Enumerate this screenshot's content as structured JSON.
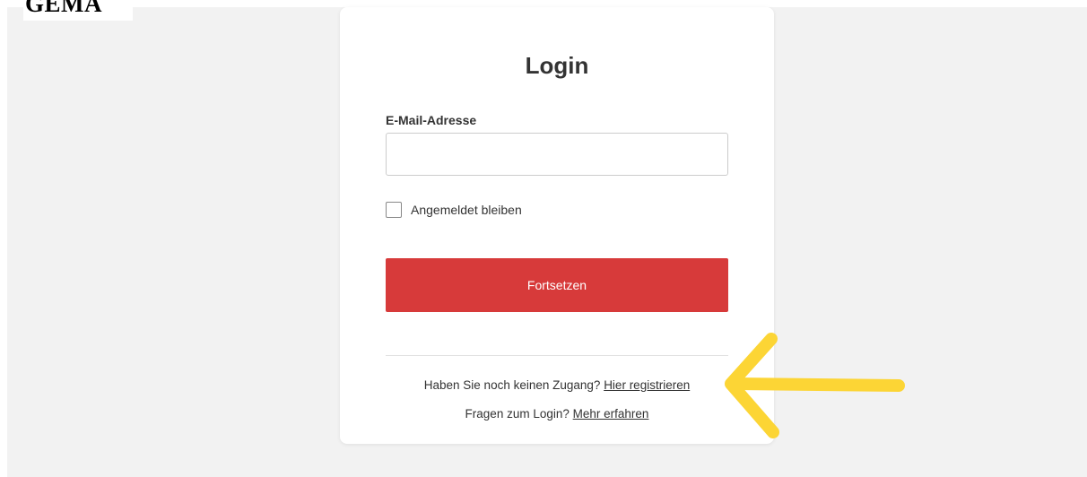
{
  "brand": {
    "logo_text": "GEMA"
  },
  "login": {
    "title": "Login",
    "email_label": "E-Mail-Adresse",
    "email_value": "",
    "email_placeholder": "",
    "remember_label": "Angemeldet bleiben",
    "remember_checked": false,
    "continue_label": "Fortsetzen"
  },
  "footer": {
    "no_account_text": "Haben Sie noch keinen Zugang?",
    "register_link": "Hier registrieren",
    "questions_text": "Fragen zum Login?",
    "learn_more_link": "Mehr erfahren"
  },
  "colors": {
    "accent_button": "#d73a3a",
    "annotation_arrow": "#fcd535",
    "page_background": "#f2f2f2"
  },
  "icons": {
    "annotation": "arrow-left-icon"
  }
}
